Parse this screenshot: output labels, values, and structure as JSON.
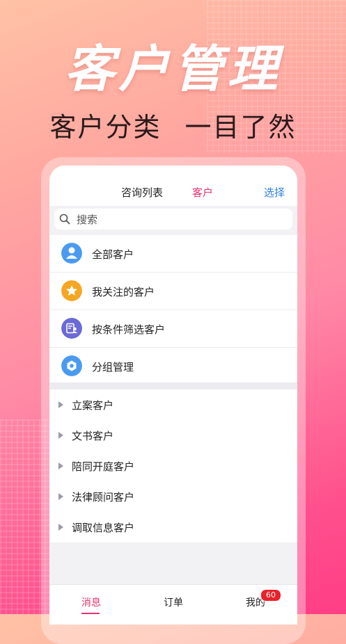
{
  "hero": {
    "title": "客户管理",
    "subtitle": "客户分类 一目了然"
  },
  "nav": {
    "tab_consult": "咨询列表",
    "tab_customer": "客户",
    "select_label": "选择"
  },
  "search": {
    "placeholder": "搜索"
  },
  "menu": {
    "items": [
      {
        "label": "全部客户",
        "icon": "person-icon",
        "color": "#4a9bf0"
      },
      {
        "label": "我关注的客户",
        "icon": "star-icon",
        "color": "#f5a623"
      },
      {
        "label": "按条件筛选客户",
        "icon": "filter-card-icon",
        "color": "#6b6ad6"
      },
      {
        "label": "分组管理",
        "icon": "hexagon-icon",
        "color": "#4a9bf0"
      }
    ]
  },
  "groups": {
    "items": [
      {
        "label": "立案客户"
      },
      {
        "label": "文书客户"
      },
      {
        "label": "陪同开庭客户"
      },
      {
        "label": "法律顾问客户"
      },
      {
        "label": "调取信息客户"
      }
    ]
  },
  "tabbar": {
    "messages": "消息",
    "orders": "订单",
    "mine": "我的",
    "mine_badge": "60"
  },
  "colors": {
    "accent": "#e8336d",
    "link": "#2f7fe6"
  }
}
